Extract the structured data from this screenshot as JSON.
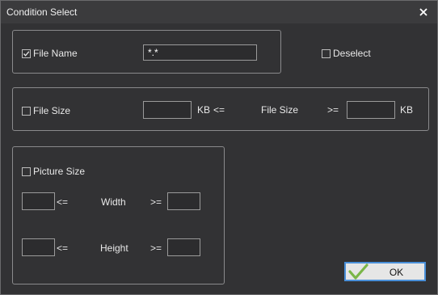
{
  "window": {
    "title": "Condition Select"
  },
  "file_name": {
    "label": "File Name",
    "checked": true,
    "value": "*.*"
  },
  "deselect": {
    "label": "Deselect",
    "checked": false
  },
  "file_size": {
    "label": "File Size",
    "checked": false,
    "min_value": "",
    "max_value": "",
    "unit1": "KB",
    "op1": "<=",
    "middle_label": "File Size",
    "op2": ">=",
    "unit2": "KB"
  },
  "picture_size": {
    "label": "Picture Size",
    "checked": false,
    "width_row": {
      "op1": "<=",
      "label": "Width",
      "op2": ">=",
      "min": "",
      "max": ""
    },
    "height_row": {
      "op1": "<=",
      "label": "Height",
      "op2": ">=",
      "min": "",
      "max": ""
    }
  },
  "ok_button": {
    "label": "OK"
  },
  "colors": {
    "accent": "#4a90d9",
    "check": "#7ab648",
    "background": "#323234"
  }
}
